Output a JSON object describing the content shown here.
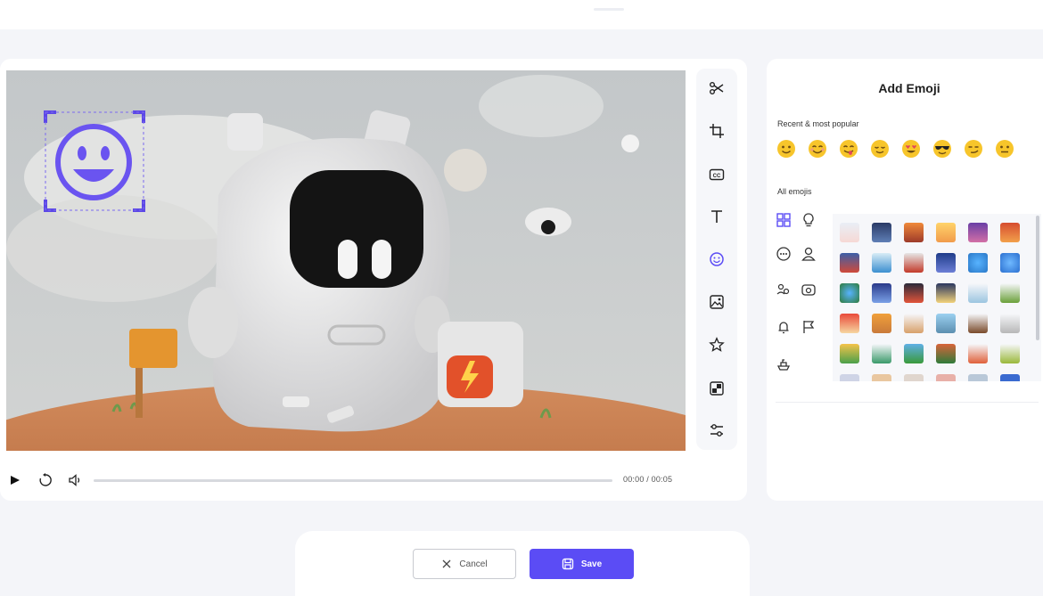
{
  "player": {
    "timecode": "00:00 / 00:05"
  },
  "tools": [
    {
      "icon": "scissors-icon"
    },
    {
      "icon": "crop-icon"
    },
    {
      "icon": "captions-icon"
    },
    {
      "icon": "text-icon"
    },
    {
      "icon": "emoji-icon"
    },
    {
      "icon": "image-icon"
    },
    {
      "icon": "star-icon"
    },
    {
      "icon": "filter-icon"
    },
    {
      "icon": "adjust-icon"
    }
  ],
  "emoji_panel": {
    "title": "Add Emoji",
    "recent_label": "Recent & most popular",
    "all_label": "All emojis",
    "recent": [
      "🙂",
      "😊",
      "😋",
      "😌",
      "😍",
      "😎",
      "😏",
      "😐"
    ],
    "categories": [
      "grid-icon",
      "bulb-icon",
      "face-icon",
      "person-icon",
      "group-icon",
      "phone-icon",
      "bell-icon",
      "flag-icon",
      "ship-icon"
    ]
  },
  "colors": {
    "accent": "#5b4cf5",
    "overlay": "#6a54f0"
  },
  "footer": {
    "cancel_label": "Cancel",
    "save_label": "Save"
  }
}
